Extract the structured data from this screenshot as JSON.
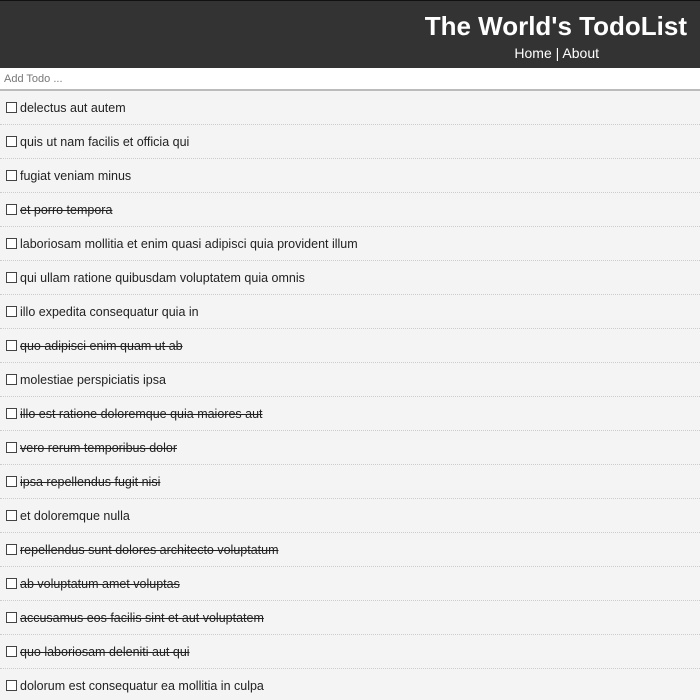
{
  "header": {
    "title": "The World's TodoList",
    "nav": {
      "home": "Home",
      "separator": "|",
      "about": "About"
    }
  },
  "add_todo": {
    "placeholder": "Add Todo ...",
    "value": ""
  },
  "todos": [
    {
      "title": "delectus aut autem",
      "completed": false
    },
    {
      "title": "quis ut nam facilis et officia qui",
      "completed": false
    },
    {
      "title": "fugiat veniam minus",
      "completed": false
    },
    {
      "title": "et porro tempora",
      "completed": true
    },
    {
      "title": "laboriosam mollitia et enim quasi adipisci quia provident illum",
      "completed": false
    },
    {
      "title": "qui ullam ratione quibusdam voluptatem quia omnis",
      "completed": false
    },
    {
      "title": "illo expedita consequatur quia in",
      "completed": false
    },
    {
      "title": "quo adipisci enim quam ut ab",
      "completed": true
    },
    {
      "title": "molestiae perspiciatis ipsa",
      "completed": false
    },
    {
      "title": "illo est ratione doloremque quia maiores aut",
      "completed": true
    },
    {
      "title": "vero rerum temporibus dolor",
      "completed": true
    },
    {
      "title": "ipsa repellendus fugit nisi",
      "completed": true
    },
    {
      "title": "et doloremque nulla",
      "completed": false
    },
    {
      "title": "repellendus sunt dolores architecto voluptatum",
      "completed": true
    },
    {
      "title": "ab voluptatum amet voluptas",
      "completed": true
    },
    {
      "title": "accusamus eos facilis sint et aut voluptatem",
      "completed": true
    },
    {
      "title": "quo laboriosam deleniti aut qui",
      "completed": true
    },
    {
      "title": "dolorum est consequatur ea mollitia in culpa",
      "completed": false
    }
  ]
}
